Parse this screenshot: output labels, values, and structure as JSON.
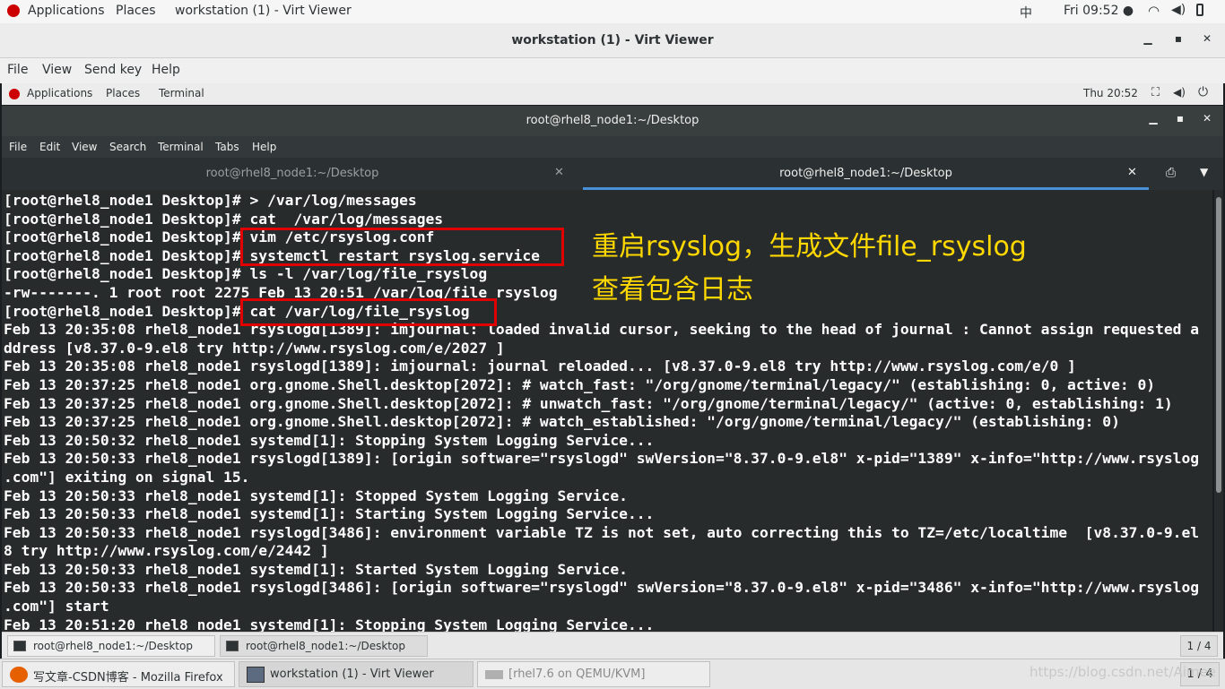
{
  "outer_topbar": {
    "applications": "Applications",
    "places": "Places",
    "window_title": "workstation (1) - Virt Viewer",
    "input_method": "中",
    "clock": "Fri 09:52 ●"
  },
  "viewer": {
    "title": "workstation (1) - Virt Viewer",
    "menu": [
      "File",
      "View",
      "Send key",
      "Help"
    ]
  },
  "guest_topbar": {
    "applications": "Applications",
    "places": "Places",
    "terminal": "Terminal",
    "clock": "Thu 20:52"
  },
  "terminal": {
    "title": "root@rhel8_node1:~/Desktop",
    "menu": [
      "File",
      "Edit",
      "View",
      "Search",
      "Terminal",
      "Tabs",
      "Help"
    ],
    "tabs": [
      "root@rhel8_node1:~/Desktop",
      "root@rhel8_node1:~/Desktop"
    ],
    "lines": [
      "[root@rhel8_node1 Desktop]# > /var/log/messages",
      "[root@rhel8_node1 Desktop]# cat  /var/log/messages",
      "[root@rhel8_node1 Desktop]# vim /etc/rsyslog.conf",
      "[root@rhel8_node1 Desktop]# systemctl restart rsyslog.service",
      "[root@rhel8_node1 Desktop]# ls -l /var/log/file_rsyslog",
      "-rw-------. 1 root root 2275 Feb 13 20:51 /var/log/file_rsyslog",
      "[root@rhel8_node1 Desktop]# cat /var/log/file_rsyslog",
      "Feb 13 20:35:08 rhel8_node1 rsyslogd[1389]: imjournal: loaded invalid cursor, seeking to the head of journal : Cannot assign requested a",
      "ddress [v8.37.0-9.el8 try http://www.rsyslog.com/e/2027 ]",
      "Feb 13 20:35:08 rhel8_node1 rsyslogd[1389]: imjournal: journal reloaded... [v8.37.0-9.el8 try http://www.rsyslog.com/e/0 ]",
      "Feb 13 20:37:25 rhel8_node1 org.gnome.Shell.desktop[2072]: # watch_fast: \"/org/gnome/terminal/legacy/\" (establishing: 0, active: 0)",
      "Feb 13 20:37:25 rhel8_node1 org.gnome.Shell.desktop[2072]: # unwatch_fast: \"/org/gnome/terminal/legacy/\" (active: 0, establishing: 1)",
      "Feb 13 20:37:25 rhel8_node1 org.gnome.Shell.desktop[2072]: # watch_established: \"/org/gnome/terminal/legacy/\" (establishing: 0)",
      "Feb 13 20:50:32 rhel8_node1 systemd[1]: Stopping System Logging Service...",
      "Feb 13 20:50:33 rhel8_node1 rsyslogd[1389]: [origin software=\"rsyslogd\" swVersion=\"8.37.0-9.el8\" x-pid=\"1389\" x-info=\"http://www.rsyslog",
      ".com\"] exiting on signal 15.",
      "Feb 13 20:50:33 rhel8_node1 systemd[1]: Stopped System Logging Service.",
      "Feb 13 20:50:33 rhel8_node1 systemd[1]: Starting System Logging Service...",
      "Feb 13 20:50:33 rhel8_node1 rsyslogd[3486]: environment variable TZ is not set, auto correcting this to TZ=/etc/localtime  [v8.37.0-9.el",
      "8 try http://www.rsyslog.com/e/2442 ]",
      "Feb 13 20:50:33 rhel8_node1 systemd[1]: Started System Logging Service.",
      "Feb 13 20:50:33 rhel8_node1 rsyslogd[3486]: [origin software=\"rsyslogd\" swVersion=\"8.37.0-9.el8\" x-pid=\"3486\" x-info=\"http://www.rsyslog",
      ".com\"] start",
      "Feb 13 20:51:20 rhel8_node1 systemd[1]: Stopping System Logging Service..."
    ]
  },
  "annotation": {
    "line1": "重启rsyslog，生成文件file_rsyslog",
    "line2": "查看包含日志"
  },
  "guest_taskbar": {
    "items": [
      "root@rhel8_node1:~/Desktop",
      "root@rhel8_node1:~/Desktop"
    ],
    "pager": "1 / 4"
  },
  "host_taskbar": {
    "items": [
      "写文章-CSDN博客 - Mozilla Firefox",
      "workstation (1) - Virt Viewer",
      "[rhel7.6 on QEMU/KVM]"
    ],
    "pager": "1 / 4",
    "watermark": "https://blog.csdn.net/Aimee"
  },
  "colors": {
    "terminal_bg": "#272b2c",
    "highlight_box": "#e00000",
    "annotation_text": "#ffd800"
  }
}
